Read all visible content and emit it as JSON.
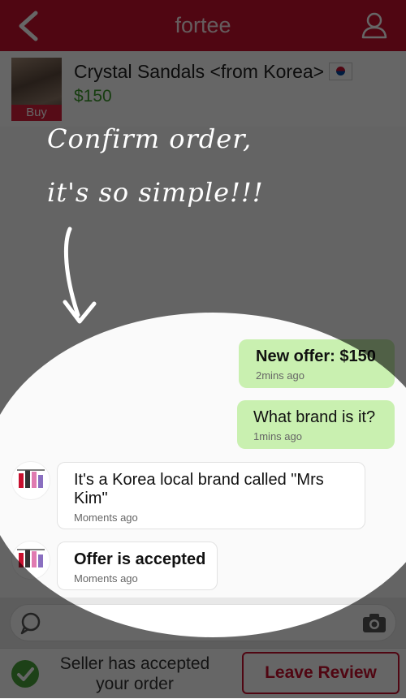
{
  "header": {
    "title": "fortee"
  },
  "product": {
    "name": "Crystal Sandals <from Korea>",
    "price": "$150",
    "buy_label": "Buy"
  },
  "overlay": {
    "line1": "Confirm order,",
    "line2": "it's so simple!!!"
  },
  "messages": [
    {
      "side": "out",
      "text": "New offer: $150",
      "bold": true,
      "time": "2mins ago"
    },
    {
      "side": "out",
      "text": "What brand is it?",
      "bold": false,
      "time": "1mins ago"
    },
    {
      "side": "in",
      "text": "It's a Korea local brand called \"Mrs Kim\"",
      "bold": false,
      "time": "Moments ago"
    },
    {
      "side": "in",
      "text": "Offer is accepted",
      "bold": true,
      "time": "Moments ago"
    }
  ],
  "footer": {
    "status_text": "Seller has accepted your order",
    "review_label": "Leave Review"
  },
  "colors": {
    "brand": "#c8102e",
    "outgoing_bubble": "#c9f0b0",
    "price": "#3a9a2a",
    "check": "#49a33a"
  }
}
